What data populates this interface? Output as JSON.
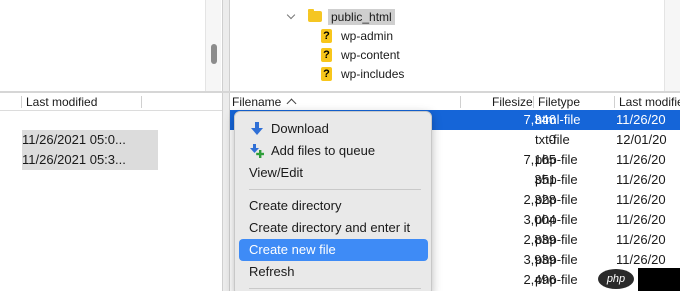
{
  "tree": {
    "folder": "public_html",
    "items": [
      "wp-admin",
      "wp-content",
      "wp-includes"
    ]
  },
  "local": {
    "last_modified_header": "Last modified",
    "rows": [
      "11/26/2021 05:0...",
      "11/26/2021 05:3..."
    ]
  },
  "remote": {
    "headers": {
      "filename": "Filename",
      "filesize": "Filesize",
      "filetype": "Filetype",
      "last_modified": "Last modifie"
    },
    "rows": [
      {
        "size": "7,346",
        "type": "html-file",
        "modified": "11/26/20"
      },
      {
        "size": "0",
        "type": "txt-file",
        "modified": "12/01/20"
      },
      {
        "size": "7,165",
        "type": "php-file",
        "modified": "11/26/20"
      },
      {
        "size": "351",
        "type": "php-file",
        "modified": "11/26/20"
      },
      {
        "size": "2,328",
        "type": "php-file",
        "modified": "11/26/20"
      },
      {
        "size": "3,004",
        "type": "php-file",
        "modified": "11/26/20"
      },
      {
        "size": "2,839",
        "type": "php-file",
        "modified": "11/26/20"
      },
      {
        "size": "3,939",
        "type": "php-file",
        "modified": "11/26/20"
      },
      {
        "size": "2,496",
        "type": "php-file",
        "modified": ""
      }
    ]
  },
  "menu": {
    "items": [
      {
        "label": "Download",
        "icon": "download-arrow-icon"
      },
      {
        "label": "Add files to queue",
        "icon": "add-to-queue-icon"
      },
      {
        "label": "View/Edit"
      },
      {
        "label": "Create directory"
      },
      {
        "label": "Create directory and enter it"
      },
      {
        "label": "Create new file"
      },
      {
        "label": "Refresh"
      }
    ],
    "highlighted": "Create new file"
  },
  "watermark": {
    "text": "php"
  },
  "colors": {
    "selection_blue": "#1565d8",
    "menu_highlight": "#3e8bf6",
    "folder_yellow": "#f5c623"
  }
}
